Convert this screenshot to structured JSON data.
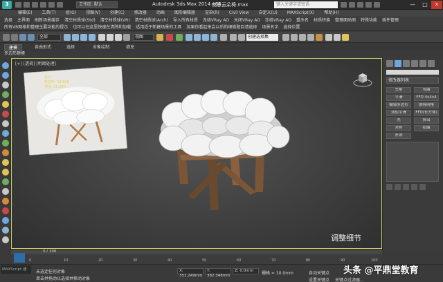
{
  "titlebar": {
    "logo": "3",
    "workspace": "工作区: 默认",
    "app_title": "Autodesk 3ds Max  2014 x64",
    "file_title": "创意云朵椅.max",
    "search_placeholder": "键入关键字或短语",
    "minimize": "—",
    "maximize": "□",
    "close": "✕"
  },
  "menubar": [
    "编辑(E)",
    "工具(T)",
    "组(G)",
    "视图(V)",
    "创建(C)",
    "修改器",
    "动画",
    "图形编辑器",
    "渲染(R)",
    "Civil View",
    "自定义(U)",
    "MAXScript(X)",
    "帮助(H)"
  ],
  "custom_toolbar_1": [
    "选择",
    "主界面",
    "刷新场景缓存",
    "清空材质球(Std)",
    "清空材质球(VR)",
    "清空材质球(Arch)",
    "导入所有材质",
    "冻结VRay AO",
    "关闭VRay AO",
    "冻结VRay AO",
    "重命名",
    "材质转换",
    "整理面贴图",
    "特殊功能",
    "插件管理"
  ],
  "custom_toolbar_2": [
    "所有VR网格和整理主要功能的提示",
    "也可以在这里快速在清除和加载",
    "适用适于新建场景的工具",
    "加果你看起来会以后的细微题目请选择",
    "场景名字",
    "选择位置"
  ],
  "main_toolbar": {
    "filter": "全部",
    "view": "视图",
    "selection_set": "创建选择集"
  },
  "ribbon": {
    "tabs": [
      "建模",
      "自由形式",
      "选择",
      "对象绘制",
      "填充"
    ],
    "subtitle": "多边形建模"
  },
  "viewport": {
    "label": "[+] [透视] [明暗处理]",
    "stats": [
      "总计",
      "多边形: 32,628",
      "顶点: 16,380"
    ],
    "caption": "调整细节"
  },
  "command_panel": {
    "modifier_list": "修改器列表",
    "buttons": [
      "车削",
      "弯曲",
      "平滑",
      "FFD 4x4x4",
      "编辑多边形",
      "删除网格",
      "涡轮平滑",
      "FFD(长方体)",
      "壳",
      "挤出",
      "对称",
      "扭曲",
      "补洞"
    ]
  },
  "timeline": {
    "frame": "0 / 100",
    "ticks": [
      "0",
      "10",
      "20",
      "30",
      "40",
      "50",
      "60",
      "70",
      "80",
      "90",
      "100"
    ]
  },
  "statusbar": {
    "maxscript": "MAXScript 迷",
    "status_line_1": "未选定任何对象",
    "status_line_2": "单击并拖动以选择并移动对象",
    "x": "X: 351.249mm",
    "y": "Y: 382.348mm",
    "z": "Z: 0.0mm",
    "grid": "栅格 = 10.0mm",
    "autokey": "自动关键点",
    "setkey": "设置关键点",
    "key_filter": "关键点过滤器..."
  },
  "watermark": "头条 @平鼎堂教育"
}
